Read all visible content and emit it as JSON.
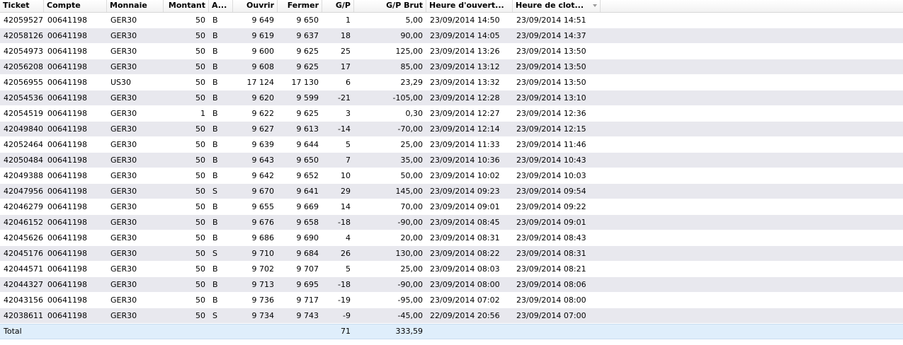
{
  "columns": {
    "ticket": "Ticket",
    "compte": "Compte",
    "monnaie": "Monnaie",
    "montant": "Montant",
    "a": "A...",
    "ouvrir": "Ouvrir",
    "fermer": "Fermer",
    "gp": "G/P",
    "gp_brut": "G/P Brut",
    "heure_ouverture": "Heure d'ouvert...",
    "heure_cloture": "Heure de clot..."
  },
  "rows": [
    {
      "ticket": "42059527",
      "compte": "00641198",
      "monnaie": "GER30",
      "montant": "50",
      "a": "B",
      "ouvrir": "9 649",
      "fermer": "9 650",
      "gp": "1",
      "gp_brut": "5,00",
      "open": "23/09/2014 14:50",
      "close": "23/09/2014 14:51"
    },
    {
      "ticket": "42058126",
      "compte": "00641198",
      "monnaie": "GER30",
      "montant": "50",
      "a": "B",
      "ouvrir": "9 619",
      "fermer": "9 637",
      "gp": "18",
      "gp_brut": "90,00",
      "open": "23/09/2014 14:05",
      "close": "23/09/2014 14:37"
    },
    {
      "ticket": "42054973",
      "compte": "00641198",
      "monnaie": "GER30",
      "montant": "50",
      "a": "B",
      "ouvrir": "9 600",
      "fermer": "9 625",
      "gp": "25",
      "gp_brut": "125,00",
      "open": "23/09/2014 13:26",
      "close": "23/09/2014 13:50"
    },
    {
      "ticket": "42056208",
      "compte": "00641198",
      "monnaie": "GER30",
      "montant": "50",
      "a": "B",
      "ouvrir": "9 608",
      "fermer": "9 625",
      "gp": "17",
      "gp_brut": "85,00",
      "open": "23/09/2014 13:12",
      "close": "23/09/2014 13:50"
    },
    {
      "ticket": "42056955",
      "compte": "00641198",
      "monnaie": "US30",
      "montant": "50",
      "a": "B",
      "ouvrir": "17 124",
      "fermer": "17 130",
      "gp": "6",
      "gp_brut": "23,29",
      "open": "23/09/2014 13:32",
      "close": "23/09/2014 13:50"
    },
    {
      "ticket": "42054536",
      "compte": "00641198",
      "monnaie": "GER30",
      "montant": "50",
      "a": "B",
      "ouvrir": "9 620",
      "fermer": "9 599",
      "gp": "-21",
      "gp_brut": "-105,00",
      "open": "23/09/2014 12:28",
      "close": "23/09/2014 13:10"
    },
    {
      "ticket": "42054519",
      "compte": "00641198",
      "monnaie": "GER30",
      "montant": "1",
      "a": "B",
      "ouvrir": "9 622",
      "fermer": "9 625",
      "gp": "3",
      "gp_brut": "0,30",
      "open": "23/09/2014 12:27",
      "close": "23/09/2014 12:36"
    },
    {
      "ticket": "42049840",
      "compte": "00641198",
      "monnaie": "GER30",
      "montant": "50",
      "a": "B",
      "ouvrir": "9 627",
      "fermer": "9 613",
      "gp": "-14",
      "gp_brut": "-70,00",
      "open": "23/09/2014 12:14",
      "close": "23/09/2014 12:15"
    },
    {
      "ticket": "42052464",
      "compte": "00641198",
      "monnaie": "GER30",
      "montant": "50",
      "a": "B",
      "ouvrir": "9 639",
      "fermer": "9 644",
      "gp": "5",
      "gp_brut": "25,00",
      "open": "23/09/2014 11:33",
      "close": "23/09/2014 11:46"
    },
    {
      "ticket": "42050484",
      "compte": "00641198",
      "monnaie": "GER30",
      "montant": "50",
      "a": "B",
      "ouvrir": "9 643",
      "fermer": "9 650",
      "gp": "7",
      "gp_brut": "35,00",
      "open": "23/09/2014 10:36",
      "close": "23/09/2014 10:43"
    },
    {
      "ticket": "42049388",
      "compte": "00641198",
      "monnaie": "GER30",
      "montant": "50",
      "a": "B",
      "ouvrir": "9 642",
      "fermer": "9 652",
      "gp": "10",
      "gp_brut": "50,00",
      "open": "23/09/2014 10:02",
      "close": "23/09/2014 10:03"
    },
    {
      "ticket": "42047956",
      "compte": "00641198",
      "monnaie": "GER30",
      "montant": "50",
      "a": "S",
      "ouvrir": "9 670",
      "fermer": "9 641",
      "gp": "29",
      "gp_brut": "145,00",
      "open": "23/09/2014 09:23",
      "close": "23/09/2014 09:54"
    },
    {
      "ticket": "42046279",
      "compte": "00641198",
      "monnaie": "GER30",
      "montant": "50",
      "a": "B",
      "ouvrir": "9 655",
      "fermer": "9 669",
      "gp": "14",
      "gp_brut": "70,00",
      "open": "23/09/2014 09:01",
      "close": "23/09/2014 09:22"
    },
    {
      "ticket": "42046152",
      "compte": "00641198",
      "monnaie": "GER30",
      "montant": "50",
      "a": "B",
      "ouvrir": "9 676",
      "fermer": "9 658",
      "gp": "-18",
      "gp_brut": "-90,00",
      "open": "23/09/2014 08:45",
      "close": "23/09/2014 09:01"
    },
    {
      "ticket": "42045626",
      "compte": "00641198",
      "monnaie": "GER30",
      "montant": "50",
      "a": "B",
      "ouvrir": "9 686",
      "fermer": "9 690",
      "gp": "4",
      "gp_brut": "20,00",
      "open": "23/09/2014 08:31",
      "close": "23/09/2014 08:43"
    },
    {
      "ticket": "42045176",
      "compte": "00641198",
      "monnaie": "GER30",
      "montant": "50",
      "a": "S",
      "ouvrir": "9 710",
      "fermer": "9 684",
      "gp": "26",
      "gp_brut": "130,00",
      "open": "23/09/2014 08:22",
      "close": "23/09/2014 08:31"
    },
    {
      "ticket": "42044571",
      "compte": "00641198",
      "monnaie": "GER30",
      "montant": "50",
      "a": "B",
      "ouvrir": "9 702",
      "fermer": "9 707",
      "gp": "5",
      "gp_brut": "25,00",
      "open": "23/09/2014 08:03",
      "close": "23/09/2014 08:21"
    },
    {
      "ticket": "42044327",
      "compte": "00641198",
      "monnaie": "GER30",
      "montant": "50",
      "a": "B",
      "ouvrir": "9 713",
      "fermer": "9 695",
      "gp": "-18",
      "gp_brut": "-90,00",
      "open": "23/09/2014 08:00",
      "close": "23/09/2014 08:06"
    },
    {
      "ticket": "42043156",
      "compte": "00641198",
      "monnaie": "GER30",
      "montant": "50",
      "a": "B",
      "ouvrir": "9 736",
      "fermer": "9 717",
      "gp": "-19",
      "gp_brut": "-95,00",
      "open": "23/09/2014 07:02",
      "close": "23/09/2014 08:00"
    },
    {
      "ticket": "42038611",
      "compte": "00641198",
      "monnaie": "GER30",
      "montant": "50",
      "a": "S",
      "ouvrir": "9 734",
      "fermer": "9 743",
      "gp": "-9",
      "gp_brut": "-45,00",
      "open": "22/09/2014 20:56",
      "close": "23/09/2014 07:00"
    }
  ],
  "total": {
    "label": "Total",
    "gp": "71",
    "gp_brut": "333,59"
  }
}
